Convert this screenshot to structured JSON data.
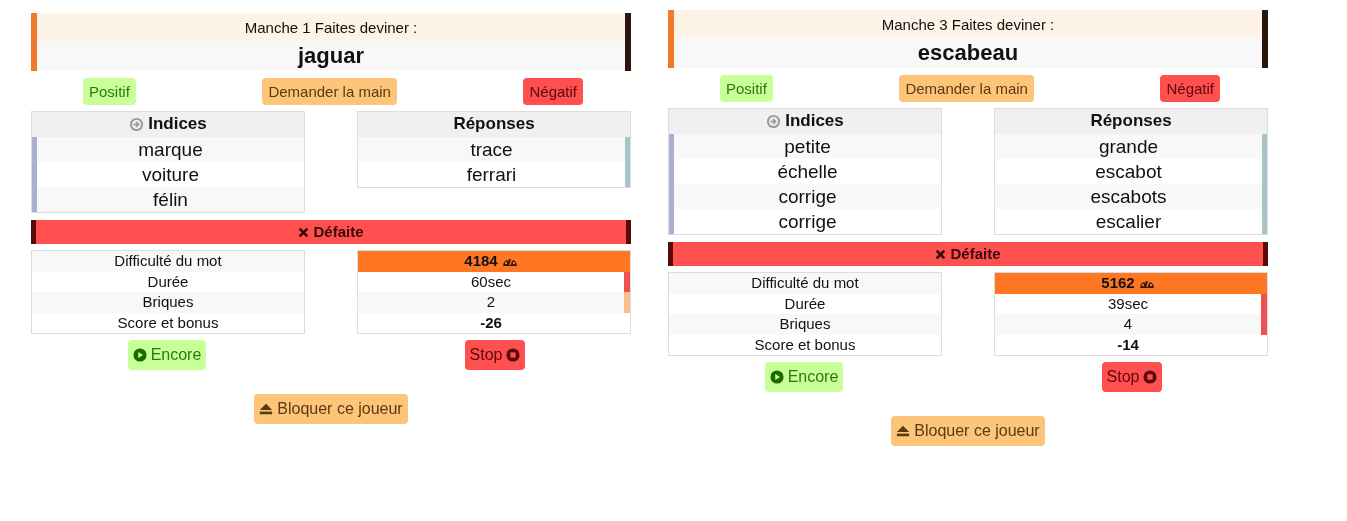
{
  "rounds": [
    {
      "title": "Manche 1 Faites deviner :",
      "word": "jaguar",
      "buttons": [
        {
          "kind": "positive",
          "label": "Positif"
        },
        {
          "kind": "ask",
          "label": "Demander la main"
        },
        {
          "kind": "negative",
          "label": "Négatif"
        }
      ],
      "clues": {
        "heading": "Indices",
        "items": [
          "marque",
          "voiture",
          "félin"
        ]
      },
      "answers": {
        "heading": "Réponses",
        "items": [
          "trace",
          "ferrari"
        ]
      },
      "result": "Défaite",
      "stats": [
        {
          "label": "Difficulté du mot",
          "value": "4184",
          "kind": "difficulty"
        },
        {
          "label": "Durée",
          "value": "60sec",
          "color": "#f05050"
        },
        {
          "label": "Briques",
          "value": "2",
          "color": "#f9c08a"
        },
        {
          "label": "Score et bonus",
          "value": "-26",
          "kind": "score"
        }
      ],
      "actions": [
        {
          "kind": "encore",
          "label": "Encore"
        },
        {
          "kind": "stop",
          "label": "Stop"
        }
      ],
      "block": "Bloquer ce joueur"
    },
    {
      "title": "Manche 3 Faites deviner :",
      "word": "escabeau",
      "buttons": [
        {
          "kind": "positive",
          "label": "Positif"
        },
        {
          "kind": "ask",
          "label": "Demander la main"
        },
        {
          "kind": "negative",
          "label": "Négatif"
        }
      ],
      "clues": {
        "heading": "Indices",
        "items": [
          "petite",
          "échelle",
          "corrige",
          "corrige"
        ]
      },
      "answers": {
        "heading": "Réponses",
        "items": [
          "grande",
          "escabot",
          "escabots",
          "escalier"
        ]
      },
      "result": "Défaite",
      "stats": [
        {
          "label": "Difficulté du mot",
          "value": "5162",
          "kind": "difficulty"
        },
        {
          "label": "Durée",
          "value": "39sec",
          "color": "#f05050"
        },
        {
          "label": "Briques",
          "value": "4",
          "color": "#f05050"
        },
        {
          "label": "Score et bonus",
          "value": "-14",
          "kind": "score"
        }
      ],
      "actions": [
        {
          "kind": "encore",
          "label": "Encore"
        },
        {
          "kind": "stop",
          "label": "Stop"
        }
      ],
      "block": "Bloquer ce joueur"
    }
  ]
}
